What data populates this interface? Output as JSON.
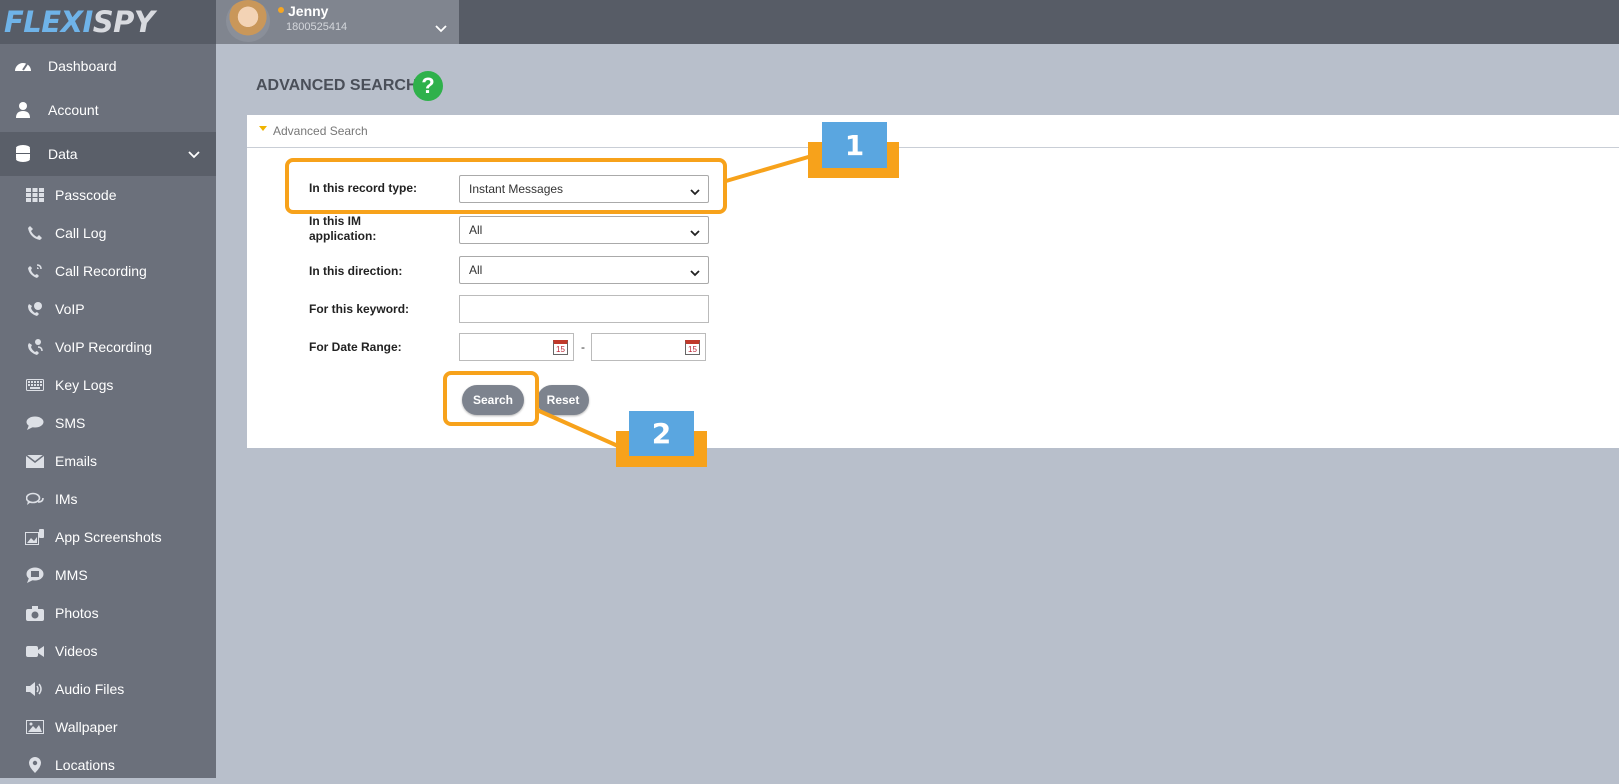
{
  "brand": {
    "logo_part1": "FLEXI",
    "logo_part2": "SPY"
  },
  "user": {
    "name": "Jenny",
    "phone": "1800525414"
  },
  "sidebar": {
    "top_items": [
      {
        "label": "Dashboard",
        "icon": "dashboard-icon"
      },
      {
        "label": "Account",
        "icon": "user-icon"
      },
      {
        "label": "Data",
        "icon": "database-icon"
      }
    ],
    "sub_items": [
      {
        "label": "Passcode",
        "icon": "grid-icon"
      },
      {
        "label": "Call Log",
        "icon": "phone-icon"
      },
      {
        "label": "Call Recording",
        "icon": "phone-recording-icon"
      },
      {
        "label": "VoIP",
        "icon": "voip-icon"
      },
      {
        "label": "VoIP Recording",
        "icon": "voip-recording-icon"
      },
      {
        "label": "Key Logs",
        "icon": "keyboard-icon"
      },
      {
        "label": "SMS",
        "icon": "chat-bubble-icon"
      },
      {
        "label": "Emails",
        "icon": "envelope-icon"
      },
      {
        "label": "IMs",
        "icon": "chat-bubbles-icon"
      },
      {
        "label": "App Screenshots",
        "icon": "screenshot-icon"
      },
      {
        "label": "MMS",
        "icon": "mms-icon"
      },
      {
        "label": "Photos",
        "icon": "camera-icon"
      },
      {
        "label": "Videos",
        "icon": "video-icon"
      },
      {
        "label": "Audio Files",
        "icon": "speaker-icon"
      },
      {
        "label": "Wallpaper",
        "icon": "image-icon"
      },
      {
        "label": "Locations",
        "icon": "location-pin-icon"
      }
    ]
  },
  "page": {
    "title": "ADVANCED SEARCH",
    "help": "?"
  },
  "panel": {
    "heading": "Advanced Search",
    "record_type": {
      "label": "In this record type:",
      "value": "Instant Messages"
    },
    "im_app": {
      "label_line1": "In this IM",
      "label_line2": "application:",
      "value": "All"
    },
    "direction": {
      "label": "In this direction:",
      "value": "All"
    },
    "keyword": {
      "label": "For this keyword:",
      "value": ""
    },
    "date_range": {
      "label": "For Date Range:",
      "from": "",
      "to": "",
      "separator": "-",
      "calendar_day": "15"
    },
    "search_label": "Search",
    "reset_label": "Reset"
  },
  "annotations": {
    "callout1": "1",
    "callout2": "2"
  },
  "colors": {
    "accent_orange": "#f7a21b",
    "callout_blue": "#5aa6e0",
    "sidebar": "#6b707b",
    "help_green": "#2fb14b"
  }
}
